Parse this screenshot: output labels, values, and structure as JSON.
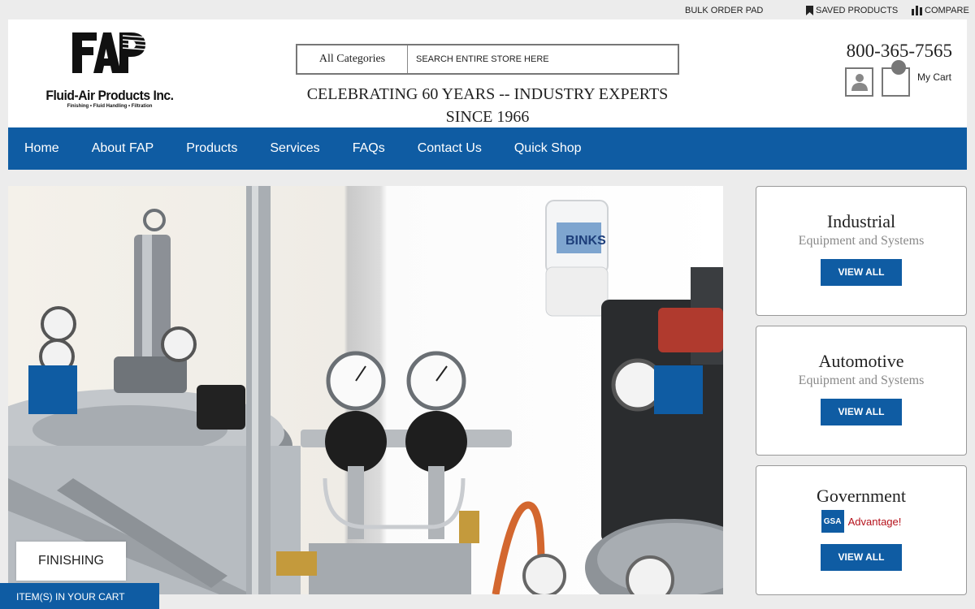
{
  "topbar": {
    "bulk_order": "BULK ORDER PAD",
    "saved_products": "SAVED PRODUCTS",
    "compare": "COMPARE"
  },
  "logo": {
    "brand": "Fluid-Air Products Inc.",
    "tagline": "Finishing • Fluid Handling • Filtration"
  },
  "search": {
    "category": "All Categories",
    "placeholder": "SEARCH ENTIRE STORE HERE"
  },
  "tagline": "CELEBRATING 60 YEARS -- INDUSTRY EXPERTS SINCE 1966",
  "phone": "800-365-7565",
  "cart": {
    "label": "My Cart"
  },
  "nav": [
    {
      "label": "Home"
    },
    {
      "label": "About FAP"
    },
    {
      "label": "Products"
    },
    {
      "label": "Services"
    },
    {
      "label": "FAQs"
    },
    {
      "label": "Contact Us"
    },
    {
      "label": "Quick Shop"
    }
  ],
  "hero": {
    "label": "FINISHING",
    "brand_mark": "BINKS"
  },
  "cards": [
    {
      "title": "Industrial",
      "subtitle": "Equipment and Systems",
      "button": "VIEW ALL"
    },
    {
      "title": "Automotive",
      "subtitle": "Equipment and Systems",
      "button": "VIEW ALL"
    },
    {
      "title": "Government",
      "gsa_box": "GSA",
      "gsa_text": "Advantage!",
      "button": "VIEW ALL"
    }
  ],
  "cart_bar": "ITEM(S) IN YOUR CART",
  "colors": {
    "brand_blue": "#0f5ca3",
    "gsa_red": "#b5121b"
  }
}
